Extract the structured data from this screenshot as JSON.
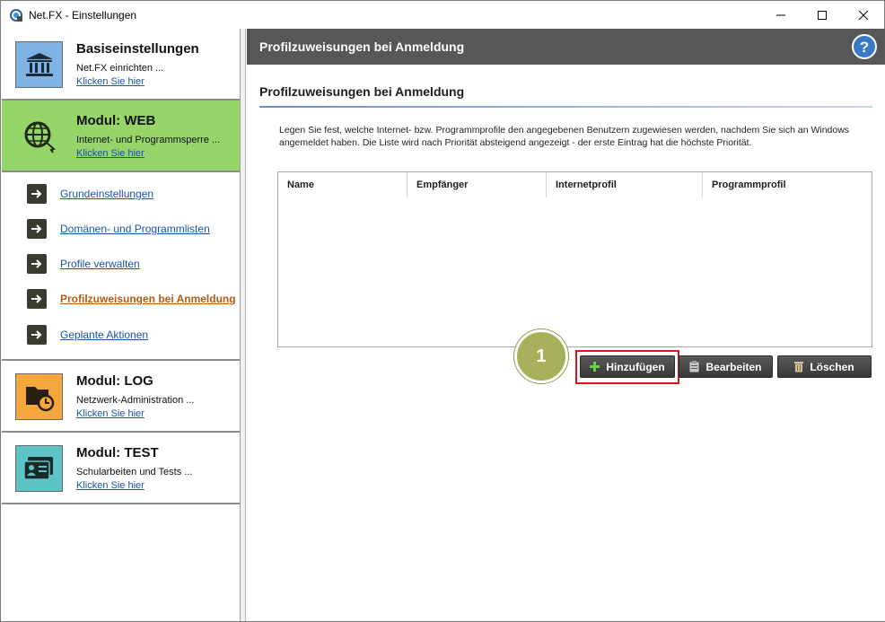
{
  "window": {
    "title": "Net.FX - Einstellungen",
    "icons": [
      "app-icon",
      "minimize-icon",
      "maximize-icon",
      "close-icon"
    ]
  },
  "sidebar": {
    "modules": [
      {
        "title": "Basiseinstellungen",
        "desc": "Net.FX einrichten ...",
        "link": "Klicken Sie hier",
        "icon": "bank-icon",
        "color": "#7fb2e5",
        "active": false
      },
      {
        "title": "Modul: WEB",
        "desc": "Internet- und Programmsperre ...",
        "link": "Klicken Sie hier",
        "icon": "globe-icon",
        "color": "#95d56a",
        "active": true
      },
      {
        "title": "Modul: LOG",
        "desc": "Netzwerk-Administration ...",
        "link": "Klicken Sie hier",
        "icon": "folder-clock-icon",
        "color": "#f5a63c",
        "active": false
      },
      {
        "title": "Modul: TEST",
        "desc": "Schularbeiten und Tests ...",
        "link": "Klicken Sie hier",
        "icon": "id-card-icon",
        "color": "#5cc4c4",
        "active": false
      }
    ],
    "subitems": [
      {
        "label": "Grundeinstellungen",
        "current": false
      },
      {
        "label": "Domänen- und Programmlisten",
        "current": false
      },
      {
        "label": "Profile verwalten",
        "current": false
      },
      {
        "label": "Profilzuweisungen bei Anmeldung",
        "current": true
      },
      {
        "label": "Geplante Aktionen",
        "current": false
      }
    ]
  },
  "main": {
    "header_title": "Profilzuweisungen bei Anmeldung",
    "section_title": "Profilzuweisungen bei Anmeldung",
    "description": "Legen Sie fest, welche Internet- bzw. Programmprofile den angegebenen Benutzern zugewiesen werden, nachdem Sie sich an Windows angemeldet haben. Die Liste wird nach Priorität absteigend angezeigt - der erste Eintrag hat die höchste Priorität.",
    "table": {
      "columns": [
        "Name",
        "Empfänger",
        "Internetprofil",
        "Programmprofil"
      ],
      "rows": []
    },
    "buttons": {
      "add": "Hinzufügen",
      "edit": "Bearbeiten",
      "delete": "Löschen"
    },
    "callout": "1"
  },
  "colors": {
    "header_bg": "#575757",
    "active_module": "#95d56a",
    "link": "#1a55a8",
    "current_link": "#b45d12",
    "highlight": "#e0141a",
    "marker": "#a7b05b"
  }
}
